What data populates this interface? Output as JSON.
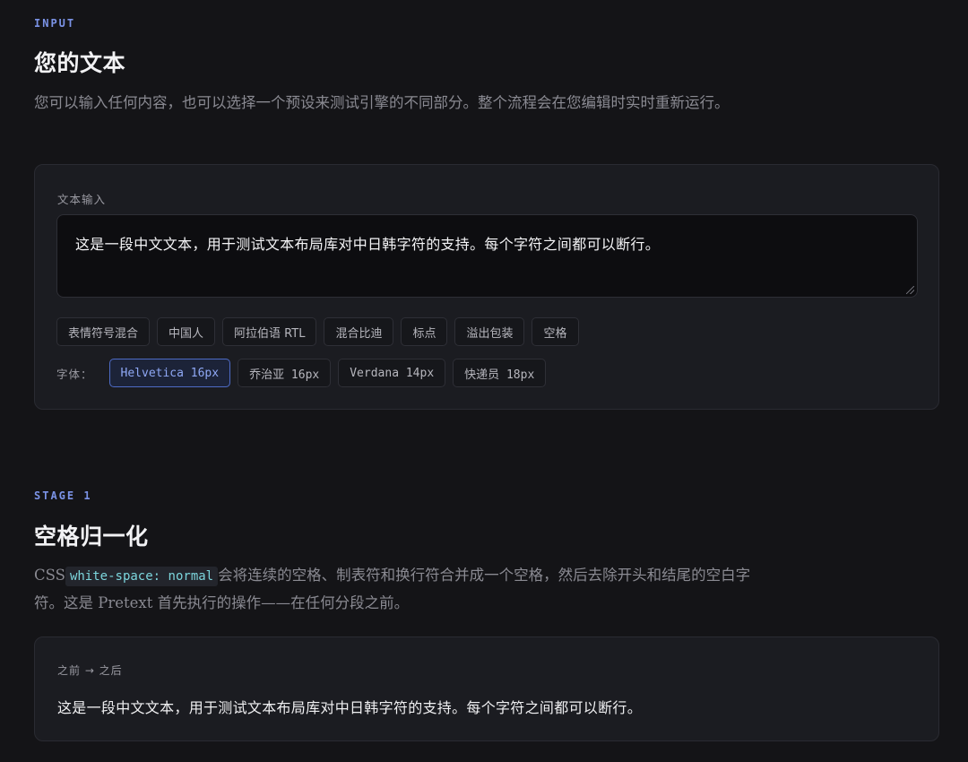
{
  "input_section": {
    "eyebrow": "INPUT",
    "heading": "您的文本",
    "description": "您可以输入任何内容，也可以选择一个预设来测试引擎的不同部分。整个流程会在您编辑时实时重新运行。",
    "field_label": "文本输入",
    "text_value": "这是一段中文文本，用于测试文本布局库对中日韩字符的支持。每个字符之间都可以断行。",
    "presets": [
      "表情符号混合",
      "中国人",
      "阿拉伯语 RTL",
      "混合比迪",
      "标点",
      "溢出包装",
      "空格"
    ],
    "font_label": "字体：",
    "fonts": [
      "Helvetica 16px",
      "乔治亚 16px",
      "Verdana 14px",
      "快递员 18px"
    ],
    "selected_font": "Helvetica 16px"
  },
  "stage_section": {
    "eyebrow": "STAGE 1",
    "heading": "空格归一化",
    "description_prefix": "CSS",
    "code": "white-space: normal",
    "description_suffix": "会将连续的空格、制表符和换行符合并成一个空格，然后去除开头和结尾的空白字符。这是 Pretext 首先执行的操作——在任何分段之前。",
    "before_after_label": "之前 → 之后",
    "result_text": "这是一段中文文本，用于测试文本布局库对中日韩字符的支持。每个字符之间都可以断行。"
  },
  "colors": {
    "background": "#141417",
    "card": "#1b1c21",
    "accent": "#7b93e6",
    "code": "#7cd6dd",
    "active_chip_border": "#4e6bc6"
  }
}
